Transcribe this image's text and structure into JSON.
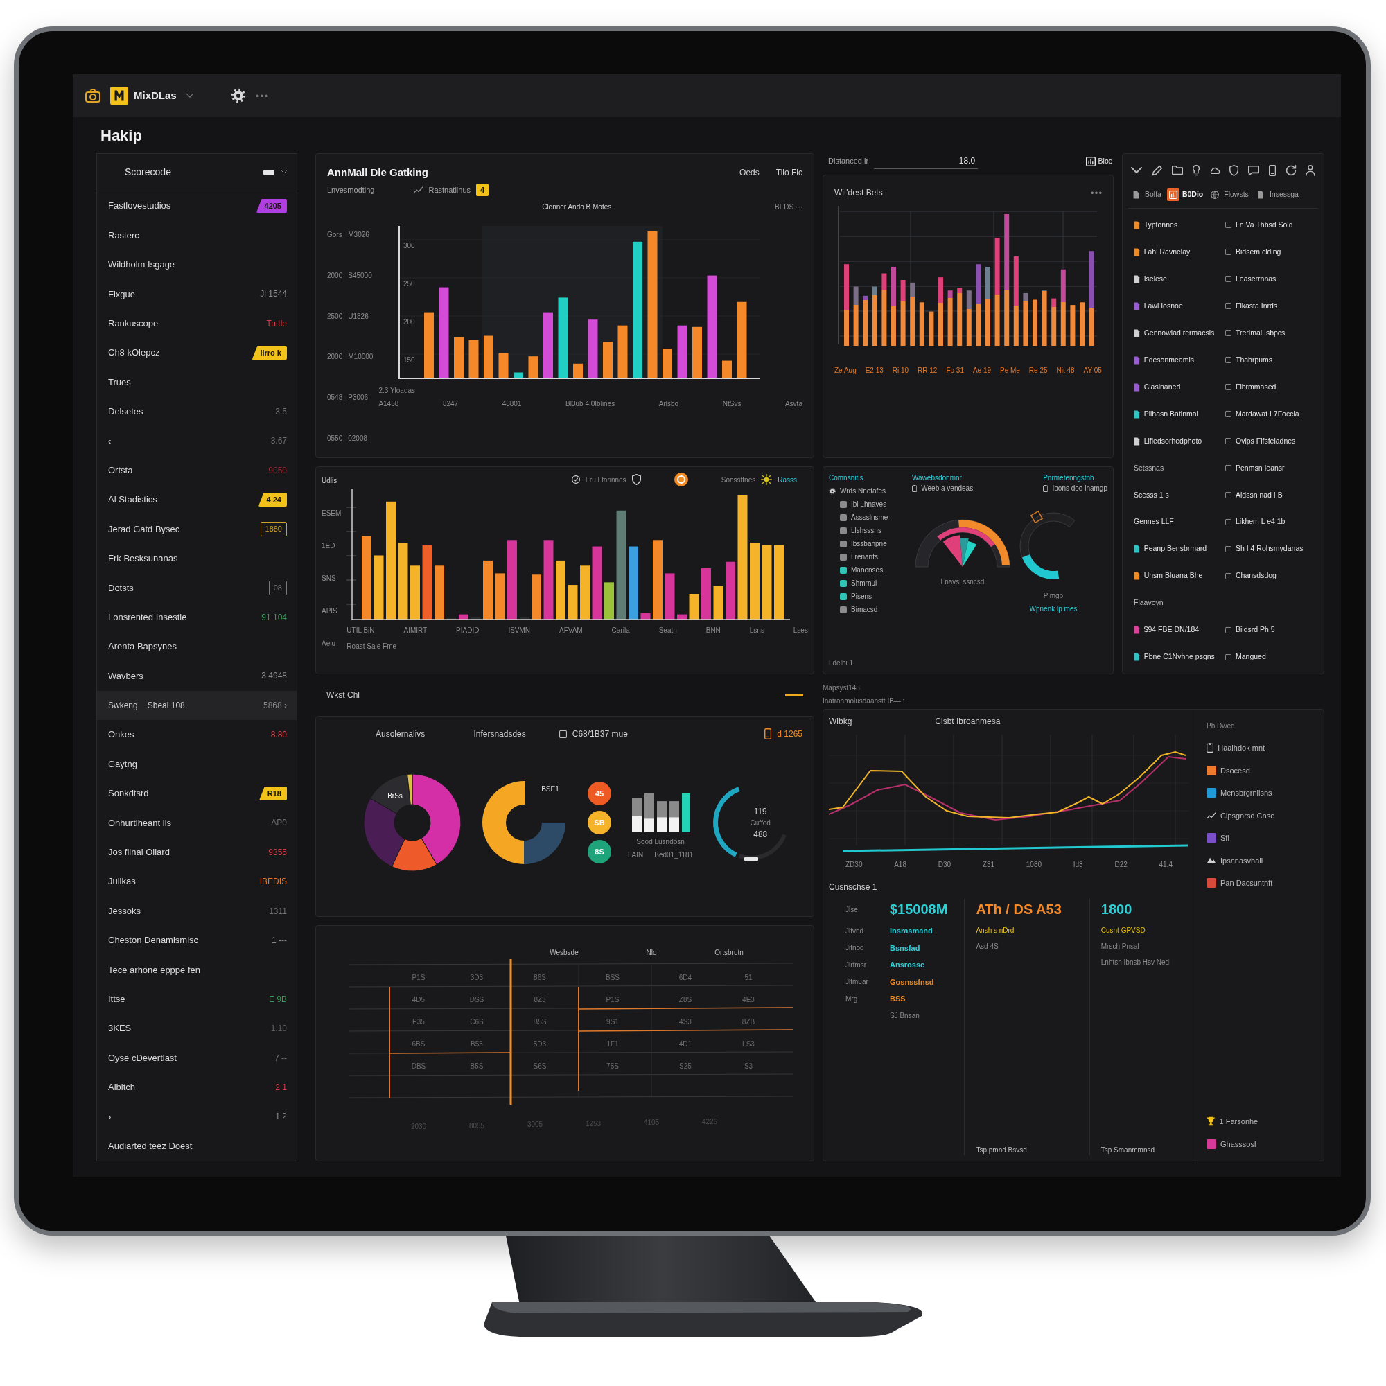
{
  "top_bar": {
    "app_name": "MixDLas"
  },
  "page_title": "Hakip",
  "sidebar": {
    "title": "Scorecode",
    "items": [
      {
        "kind": "tag",
        "label": "Fastlovestudios",
        "value": "4205",
        "color": "#b03ee0"
      },
      {
        "kind": "plain",
        "label": "Rasterc"
      },
      {
        "kind": "plain",
        "label": "Wildholm Isgage"
      },
      {
        "kind": "value",
        "label": "Fixgue",
        "value": "Jl 1544",
        "color": "#8c8c8c"
      },
      {
        "kind": "value",
        "label": "Rankuscope",
        "value": "Tuttle",
        "color": "#c8404a"
      },
      {
        "kind": "tag",
        "label": "Ch8 kOlepcz",
        "value": "Ilrro k",
        "color": "#f2c21b"
      },
      {
        "kind": "plain",
        "label": "Trues"
      },
      {
        "kind": "value",
        "label": "Delsetes",
        "value": "3.5",
        "color": "#6e6e6e"
      },
      {
        "kind": "value",
        "label": "‹",
        "value": "3.67",
        "color": "#6e6e6e"
      },
      {
        "kind": "value",
        "label": "Ortsta",
        "value": "9050",
        "color": "#8a2d36"
      },
      {
        "kind": "tag",
        "label": "Al Stadistics",
        "value": "4 24",
        "color": "#f2c21b"
      },
      {
        "kind": "outline",
        "label": "Jerad Gatd Bysec",
        "value": "1880",
        "color": "#c9a227"
      },
      {
        "kind": "plain",
        "label": "Frk Besksunanas"
      },
      {
        "kind": "outline",
        "label": "Dotsts",
        "value": "08",
        "color": "#7a7a7a"
      },
      {
        "kind": "value",
        "label": "Lonsrented Insestie",
        "value": "91 104",
        "color": "#3a9a5a"
      },
      {
        "kind": "plain",
        "label": "Arenta Bapsynes"
      },
      {
        "kind": "value",
        "label": "Wavbers",
        "value": "3 4948",
        "color": "#8a8a8a"
      },
      {
        "kind": "section",
        "label": "Swkeng",
        "value": "Sbeal 108",
        "extra": "5868 ›"
      },
      {
        "kind": "value",
        "label": "Onkes",
        "value": "8.80",
        "color": "#d0454f"
      },
      {
        "kind": "plain",
        "label": "Gaytng"
      },
      {
        "kind": "tag",
        "label": "Sonkdtsrd",
        "value": "R18",
        "color": "#f2c21b"
      },
      {
        "kind": "value",
        "label": "Onhurtiheant lis",
        "value": "AP0",
        "color": "#6e6e6e"
      },
      {
        "kind": "value",
        "label": "Jos flinal Ollard",
        "value": "9355",
        "color": "#c8404a"
      },
      {
        "kind": "value",
        "label": "Julikas",
        "value": "IBEDIS",
        "color": "#e8742c"
      },
      {
        "kind": "value",
        "label": "Jessoks",
        "value": "1311",
        "color": "#6e6e6e"
      },
      {
        "kind": "value",
        "label": "Cheston Denamismisc",
        "value": "1 ---",
        "color": "#8a8a8a"
      },
      {
        "kind": "plain",
        "label": "Tece arhone epppe fen"
      },
      {
        "kind": "value",
        "label": "Ittse",
        "value": "E 9B",
        "color": "#3a9a5a"
      },
      {
        "kind": "value",
        "label": "3KES",
        "value": "1.10",
        "color": "#5e5e5e"
      },
      {
        "kind": "value",
        "label": "Oyse cDevertlast",
        "value": "7 --",
        "color": "#7a7a7a"
      },
      {
        "kind": "value",
        "label": "Albitch",
        "value": "2 1",
        "color": "#c8404a"
      },
      {
        "kind": "value",
        "label": "›",
        "value": "1 2",
        "color": "#8a8a8a"
      },
      {
        "kind": "plain",
        "label": "Audiarted teez Doest"
      }
    ]
  },
  "sales_chart": {
    "title": "AnnMall Dle Gatking",
    "header_links": [
      "Oeds",
      "Tilo Fic"
    ],
    "subtitle": "Lnvesmodting",
    "legend_label": "Rastnatlinus",
    "legend_badge": "4",
    "chart_title": "Clenner Ando B Motes",
    "corner": "BEDS ···",
    "y_outer": [
      "Gors",
      "2000",
      "2500",
      "2000",
      "0548",
      "0550"
    ],
    "y_inner": [
      "M3026",
      "S45000",
      "U1826",
      "M10000",
      "P3006",
      "02008"
    ],
    "y_ticks": [
      "300",
      "250",
      "200",
      "150"
    ],
    "baseline_note": "2.3 Yloadas",
    "x_labels": [
      "A1458",
      "8247",
      "48801",
      "Bl3ub 4I0Iblines",
      "Arlsbo",
      "NtSvs",
      "Asvta"
    ]
  },
  "distance_filter": {
    "tab": "Bloc",
    "label": "Distanced ir",
    "value": "18.0"
  },
  "stack_chart": {
    "title": "Wit'dest Bets",
    "x_labels": [
      "Ze Aug",
      "E2 13",
      "Ri 10",
      "RR 12",
      "Fo 31",
      "Ae 19",
      "Pe Me",
      "Re 25",
      "Nit 48",
      "AY 05"
    ]
  },
  "info_panel": {
    "tabs": [
      {
        "label": "Bolfa",
        "selected": false
      },
      {
        "label": "B0Dio",
        "selected": true
      },
      {
        "label": "Flowsts",
        "selected": false
      },
      {
        "label": "Insessga",
        "selected": false
      }
    ],
    "entries": [
      {
        "kind": "pair",
        "left": "Typtonnes",
        "color": "#f08a24",
        "right": "Ln Va Thbsd Sold"
      },
      {
        "kind": "pair",
        "left": "Lahl Ravnelay",
        "color": "#f08a24",
        "right": "Bidsem clding"
      },
      {
        "kind": "pair",
        "left": "Iseiese",
        "color": "#d0d0d0",
        "right": "Leaserrnnas"
      },
      {
        "kind": "pair",
        "left": "Lawi Iosnoe",
        "color": "#9b5bd6",
        "right": "Fikasta Inrds"
      },
      {
        "kind": "pair",
        "left": "Gennowlad rermacsls",
        "color": "#d0d0d0",
        "right": "Trerimal Isbpcs"
      },
      {
        "kind": "pair",
        "left": "Edesonmeamis",
        "color": "#9b5bd6",
        "right": "Thabrpums"
      },
      {
        "kind": "pair",
        "left": "Clasinaned",
        "color": "#9b5bd6",
        "right": "Fibrmmased"
      },
      {
        "kind": "pair",
        "left": "Pllhasn Batinmal",
        "color": "#2ec4c4",
        "right": "Mardawat L7Foccia"
      },
      {
        "kind": "pair",
        "left": "Lifiedsorhedphoto",
        "color": "#d0d0d0",
        "right": "Ovips Fifsfeladnes"
      },
      {
        "kind": "heading",
        "left": "Setssnas",
        "right": "Penmsn Ieansr"
      },
      {
        "kind": "plain",
        "left": "Scesss 1 s",
        "right": "Aldssn nad I B"
      },
      {
        "kind": "plain",
        "left": "Gennes LLF",
        "right": "Likhem L e4 1b"
      },
      {
        "kind": "pair",
        "left": "Peanp Bensbrmard",
        "color": "#2ec4c4",
        "right": "Sh I 4 Rohsmydanas"
      },
      {
        "kind": "pair",
        "left": "Uhsm Bluana Bhe",
        "color": "#f08a24",
        "right": "Chansdsdog"
      },
      {
        "kind": "heading",
        "left": "Flaavoyn"
      },
      {
        "kind": "pair",
        "left": "$94 FBE DN/184",
        "color": "#e0409a",
        "right": "Bildsrd Ph 5"
      },
      {
        "kind": "pair",
        "left": "Pbne C1Nvhne psgns",
        "color": "#2ec4c4",
        "right": "Mangued"
      }
    ]
  },
  "activity_chart": {
    "y_title": "Udlis",
    "y_labels": [
      "ESEM",
      "1ED",
      "SNS",
      "APIS",
      "Aeiu"
    ],
    "legend": [
      "Fru Lfnrinnes",
      "Sonsstfnes",
      "Rasss"
    ],
    "x_labels": [
      "UTIL BiN",
      "AIMIRT",
      "PIADID",
      "ISVMN",
      "AFVAM",
      "Carila",
      "Seatn",
      "BNN",
      "Lsns",
      "Lses"
    ],
    "footer": "Roast Sale Fme"
  },
  "gauge_panel": {
    "legend_title": "Comnsnitis",
    "legend_subtitle": "Wrds Nnefafes",
    "legend_items": [
      {
        "label": "Ibi Lhnaves",
        "color": "#8a8a8a"
      },
      {
        "label": "Asssslnsme",
        "color": "#8a8a8a"
      },
      {
        "label": "Llshsssns",
        "color": "#8a8a8a"
      },
      {
        "label": "Ibssbanpne",
        "color": "#8a8a8a"
      },
      {
        "label": "Lrenants",
        "color": "#8a8a8a"
      },
      {
        "label": "Manenses",
        "color": "#2ec4b6"
      },
      {
        "label": "Shmrnul",
        "color": "#2ec4b6"
      },
      {
        "label": "Pisens",
        "color": "#2ec4b6"
      },
      {
        "label": "Bimacsd",
        "color": "#8a8a8a"
      }
    ],
    "footer": "Ldelbi 1",
    "gauges": [
      {
        "title": "Wawebsdonmnr",
        "subtitle": "Weeb a vendeas",
        "label": "Lnavsl ssncsd"
      },
      {
        "title": "Pnrmetenngstnb",
        "subtitle": "Ibons doo lnamgp",
        "label": "Pimgp",
        "note": "Wpnenk lp mes"
      }
    ]
  },
  "section_heading": "Wkst Chl",
  "donut_panel": {
    "titles": [
      "Ausolernalivs",
      "Infersnadsdes"
    ],
    "info": "C68/1B37 mue",
    "badge": "d 1265",
    "donut_labels": [
      "BrSs",
      "BSE1"
    ],
    "bubbles": [
      {
        "text": "45",
        "color": "#ee5a24"
      },
      {
        "text": "SB",
        "color": "#f4b328"
      },
      {
        "text": "8S",
        "color": "#1fa37a"
      }
    ],
    "bubble_note": "LAIN",
    "bars_caption": "Sood Lusndosn",
    "bars_value": "Bed01_1181",
    "ring_lines": [
      "119",
      "Cuffed",
      "488"
    ]
  },
  "data_table": {
    "headers": [
      "Wesbsde",
      "Nlo",
      "Ortsbrutn"
    ],
    "rows": [
      [
        "P1S",
        "3D3",
        "86S",
        "BSS",
        "6D4",
        "51"
      ],
      [
        "4D5",
        "DSS",
        "8Z3",
        "P1S",
        "Z8S",
        "4E3"
      ],
      [
        "P35",
        "C6S",
        "B5S",
        "9S1",
        "4S3",
        "8ZB"
      ],
      [
        "6BS",
        "B55",
        "5D3",
        "1F1",
        "4D1",
        "LS3"
      ],
      [
        "DBS",
        "B5S",
        "S6S",
        "75S",
        "S25",
        "S3"
      ]
    ],
    "x_labels": [
      "2030",
      "8055",
      "3005",
      "1253",
      "4105",
      "4226"
    ]
  },
  "trend_panel": {
    "heading": "Mapsyst148",
    "subheading": "Inatranmolusdaanstt IB— :",
    "chart_label": "Wibkg",
    "chart_title": "Clsbt Ibroanmesa",
    "x_labels": [
      "ZD30",
      "A18",
      "D30",
      "Z31",
      "1080",
      "Id3",
      "D22",
      "41.4"
    ],
    "legend_title": "Pb Dwed",
    "legend": [
      {
        "kind": "icon",
        "label": "Haalhdok mnt"
      },
      {
        "kind": "swatch",
        "label": "Dsocesd",
        "color": "#f07a2c"
      },
      {
        "kind": "swatch",
        "label": "Mensbrgrnilsns",
        "color": "#1f9ad6"
      },
      {
        "kind": "icon",
        "label": "Cipsgnrsd Cnse"
      },
      {
        "kind": "swatch",
        "label": "Sfi",
        "color": "#7b4fc8"
      },
      {
        "kind": "icon",
        "label": "Ipsnnasvhall"
      },
      {
        "kind": "swatch",
        "label": "Pan Dacsuntnft",
        "color": "#d84a3a"
      },
      {
        "kind": "icon",
        "label": "1 Farsonhe"
      },
      {
        "kind": "swatch",
        "label": "Ghasssosl",
        "color": "#d83a9a"
      }
    ],
    "summary": {
      "title": "Cusnschse 1",
      "rows": [
        {
          "label": "Jlse",
          "value": "$15008M",
          "color": "#2ed0d8"
        },
        {
          "label": "Jlfvnd",
          "value": "Insrasmand",
          "color": "#2ed0d8"
        },
        {
          "label": "Jifnod",
          "value": "Bsnsfad",
          "color": "#2ed0d8"
        },
        {
          "label": "Jirfmsr",
          "value": "Ansrosse",
          "color": "#2ed0d8"
        },
        {
          "label": "Jlfmuar",
          "value": "Gosnssfnsd",
          "color": "#f08a24"
        },
        {
          "label": "Mrg",
          "value": "BSS",
          "color": "#f08a24"
        }
      ],
      "rows_note": "SJ Bnsan",
      "cards": [
        {
          "value": "ATh / DS A53",
          "color": "#f5892a",
          "highlight": "Ansh s nDrd",
          "lines": [
            "Asd 4S"
          ],
          "footer": "Tsp pmnd Bsvsd"
        },
        {
          "value": "1800",
          "color": "#2ed0d8",
          "highlight": "Cusnt GPVSD",
          "lines": [
            "Mrsch Pnsal",
            "Lnhtsh Ibnsb Hsv Nedl"
          ],
          "footer": "Tsp Smanmmnsd"
        }
      ]
    }
  }
}
